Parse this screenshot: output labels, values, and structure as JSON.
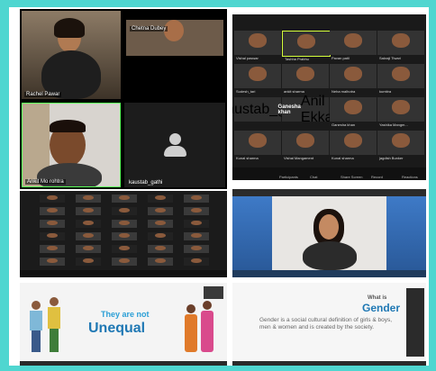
{
  "panels": {
    "p1": {
      "participants": [
        {
          "name": "Rachel Pawar"
        },
        {
          "name": "Chetna Dubey"
        },
        {
          "name": "Ankit Mo rohtra"
        },
        {
          "name": "kaustab_gathi"
        }
      ]
    },
    "p2": {
      "grid_labels": [
        "Vishal paswar",
        "Tashha Prabhu",
        "Pavan patil",
        "Sakraji Tiwari",
        "Sudesh_tari",
        "ankit sharma",
        "Neha malhotra",
        "kumitra",
        "kaustab_gathi",
        "Anil Ekka",
        "Ganesha khan",
        "Yashika Mangm...",
        "Kunal sharma",
        "Vishal Mangament",
        "Kunal sharma",
        "jagdish Bunker"
      ],
      "name_tiles": [
        "Anil Ekka",
        "Ganesha khan",
        "Yashika Mangm...",
        "Kunal sharma"
      ],
      "toolbar": [
        "Participants",
        "Chat",
        "Share Screen",
        "Record",
        "Reactions"
      ]
    },
    "p5": {
      "slide_text": "They are not",
      "slide_big": "Unequal"
    },
    "p6": {
      "slide_title_small": "What is",
      "slide_title_big": "Gender",
      "slide_body": "Gender is a social cultural definition of girls & boys, men & women and is created by the society."
    }
  },
  "colors": {
    "frame": "#4fd6d0",
    "slide_blue": "#1f78b4"
  }
}
